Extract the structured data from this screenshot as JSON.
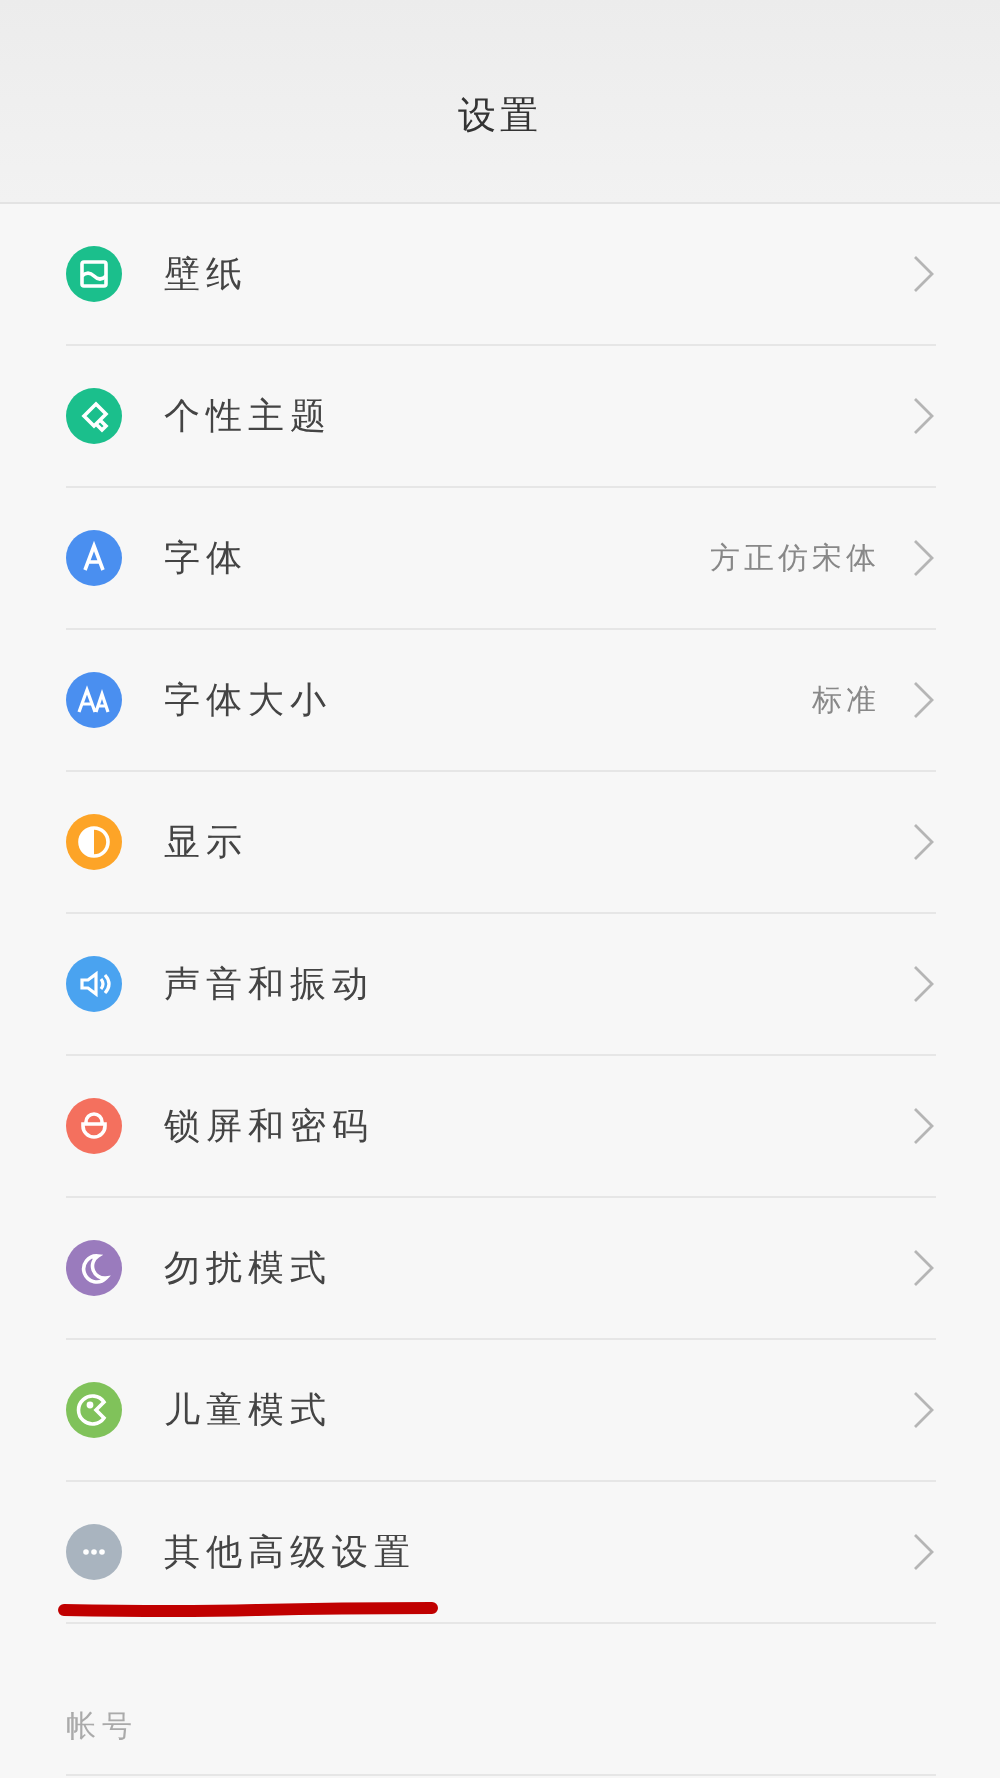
{
  "header": {
    "title": "设置"
  },
  "items": [
    {
      "label": "壁纸",
      "color": "#1bbf8c",
      "annotated": false
    },
    {
      "label": "个性主题",
      "color": "#1bbf8c",
      "annotated": false
    },
    {
      "label": "字体",
      "value": "方正仿宋体",
      "color": "#4a8ff0",
      "annotated": false
    },
    {
      "label": "字体大小",
      "value": "标准",
      "color": "#4a8ff0",
      "annotated": false
    },
    {
      "label": "显示",
      "color": "#fda427",
      "annotated": false
    },
    {
      "label": "声音和振动",
      "color": "#4aa3f0",
      "annotated": false
    },
    {
      "label": "锁屏和密码",
      "color": "#f4705e",
      "annotated": false
    },
    {
      "label": "勿扰模式",
      "color": "#9a7bbd",
      "annotated": false
    },
    {
      "label": "儿童模式",
      "color": "#80c25a",
      "annotated": false
    },
    {
      "label": "其他高级设置",
      "color": "#a9b4bf",
      "annotated": true
    }
  ],
  "section": {
    "title": "帐号"
  }
}
